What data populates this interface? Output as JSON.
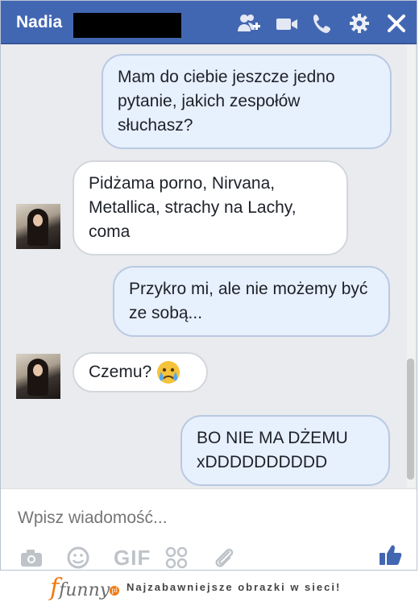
{
  "header": {
    "contact_name": "Nadia",
    "icons": [
      "add-friend-icon",
      "video-call-icon",
      "phone-icon",
      "gear-icon",
      "close-icon"
    ],
    "bar_color": "#4267b2"
  },
  "messages": [
    {
      "side": "out",
      "text": "Mam do ciebie jeszcze jedno pytanie, jakich zespołów słuchasz?"
    },
    {
      "side": "in",
      "text": "Pidżama porno, Nirvana, Metallica, strachy na Lachy, coma"
    },
    {
      "side": "out",
      "text": "Przykro mi, ale nie możemy być ze sobą..."
    },
    {
      "side": "in",
      "text": "Czemu?",
      "emoji": "crying-face-icon"
    },
    {
      "side": "out",
      "text": "BO NIE MA DŻEMU xDDDDDDDDDD"
    }
  ],
  "composer": {
    "placeholder": "Wpisz wiadomość...",
    "gif_label": "GIF",
    "icons": [
      "camera-icon",
      "smiley-icon",
      "gif-icon",
      "stickers-icon",
      "paperclip-icon",
      "thumbs-up-icon"
    ],
    "like_color": "#4267b2"
  },
  "footer": {
    "brand": "funny",
    "brand_suffix": "pl",
    "slogan": "Najzabawniejsze obrazki w sieci!"
  }
}
